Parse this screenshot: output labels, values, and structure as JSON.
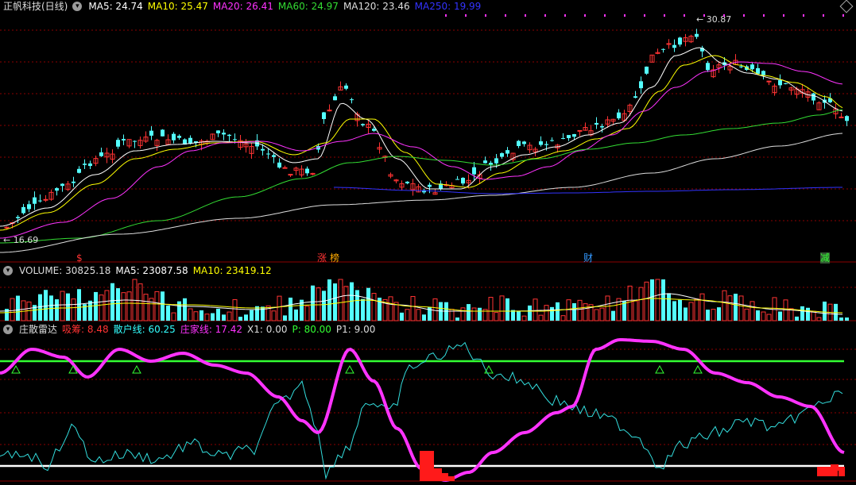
{
  "main": {
    "title": "正帆科技(日线)",
    "ma": [
      {
        "label": "MA5: 24.74",
        "color": "#ffffff"
      },
      {
        "label": "MA10: 25.47",
        "color": "#ffff00"
      },
      {
        "label": "MA20: 26.41",
        "color": "#ff33ff"
      },
      {
        "label": "MA60: 24.97",
        "color": "#33dd33"
      },
      {
        "label": "MA120: 23.46",
        "color": "#dddddd"
      },
      {
        "label": "MA250: 19.99",
        "color": "#3333ff"
      }
    ],
    "high_label": "30.87",
    "low_label": "16.69",
    "markers": [
      {
        "text": "$",
        "color": "#ff3333"
      },
      {
        "text": "涨",
        "color": "#ff3333"
      },
      {
        "text": "榜",
        "color": "#ffaa00"
      },
      {
        "text": "财",
        "color": "#3399ff"
      },
      {
        "text": "减",
        "color": "#33ff33"
      }
    ]
  },
  "volume": {
    "label": "VOLUME: 30825.18",
    "ma5": "MA5: 23087.58",
    "ma10": "MA10: 23419.12"
  },
  "radar": {
    "title": "庄散雷达",
    "items": [
      {
        "label": "吸筹: 8.48",
        "color": "#ff3333"
      },
      {
        "label": "散户线: 60.25",
        "color": "#33ffff"
      },
      {
        "label": "庄家线: 17.42",
        "color": "#ff33ff"
      },
      {
        "label": "X1: 0.00",
        "color": "#dddddd"
      },
      {
        "label": "P: 80.00",
        "color": "#33ff33"
      },
      {
        "label": "P1: 9.00",
        "color": "#dddddd"
      }
    ]
  },
  "colors": {
    "up": "#ff3333",
    "down": "#54ffff",
    "grid": "#8b0000"
  }
}
